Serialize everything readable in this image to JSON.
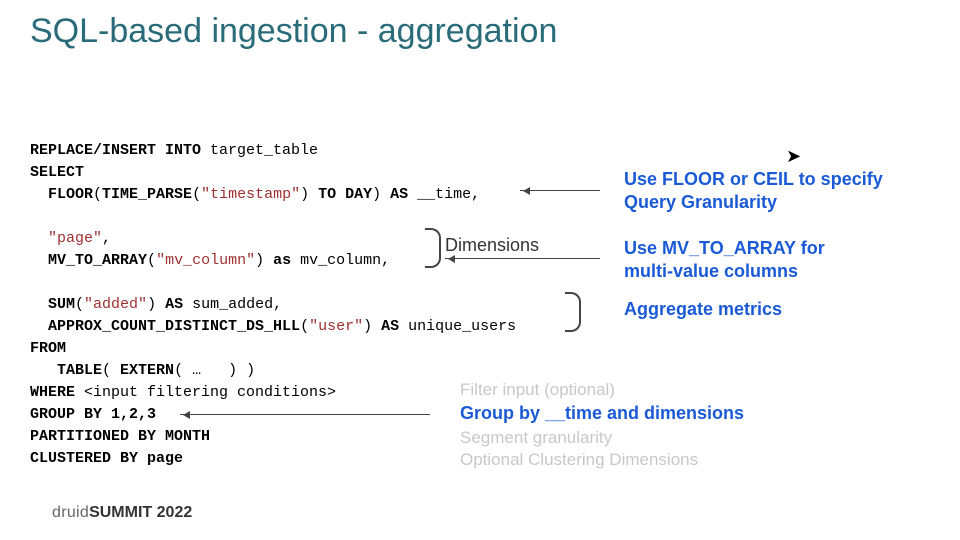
{
  "title": "SQL-based ingestion - aggregation",
  "code_html": "<b>REPLACE/INSERT INTO</b> target_table\n<b>SELECT</b>\n  <b>FLOOR</b>(<b>TIME_PARSE</b>(<span class=\"str\">\"timestamp\"</span>) <b>TO DAY</b>) <b>AS</b> __time,\n\n  <span class=\"str\">\"page\"</span>,\n  <b>MV_TO_ARRAY</b>(<span class=\"str\">\"mv_column\"</span>) <b>as</b> mv_column,\n\n  <b>SUM</b>(<span class=\"str\">\"added\"</span>) <b>AS</b> sum_added,\n  <b>APPROX_COUNT_DISTINCT_DS_HLL</b>(<span class=\"str\">\"user\"</span>) <b>AS</b> unique_users\n<b>FROM</b>\n   <b>TABLE</b>( <b>EXTERN</b>( …   ) )\n<b>WHERE</b> &lt;input filtering conditions&gt;\n<b>GROUP BY 1,2,3</b>\n<b>PARTITIONED BY MONTH</b>\n<b>CLUSTERED BY page</b>",
  "dimensions_label": "Dimensions",
  "annotations": {
    "granularity": "Use FLOOR or CEIL to specify\nQuery Granularity",
    "mv": "Use MV_TO_ARRAY for\nmulti-value columns",
    "agg": "Aggregate metrics",
    "filter": "Filter input (optional)",
    "group": "Group by __time and dimensions",
    "segment": "Segment granularity",
    "cluster": "Optional Clustering Dimensions"
  },
  "footer": {
    "brand": "druid",
    "event": "SUMMIT",
    "year": "2022"
  }
}
